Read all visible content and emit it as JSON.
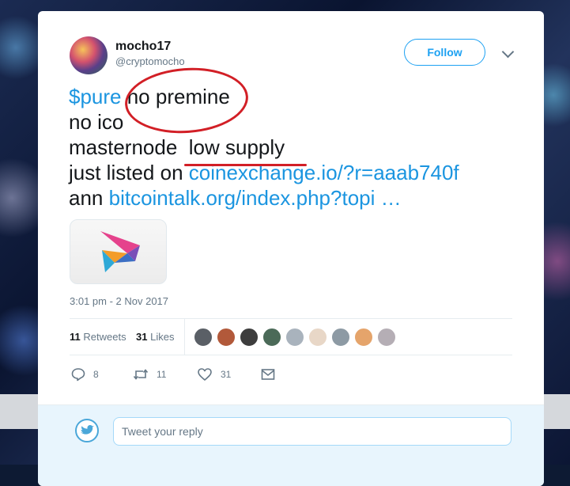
{
  "author": {
    "display_name": "mocho17",
    "handle": "@cryptomocho"
  },
  "follow_label": "Follow",
  "tweet": {
    "cashtag": "$pure",
    "line1_rest": " no premine",
    "line2": "no ico",
    "line3": "masternode  low supply",
    "line4_prefix": "just listed on ",
    "line4_link": "coinexchange.io/?r=aaab740f",
    "line5_prefix": "ann ",
    "line5_link": "bitcointalk.org/index.php?topi …"
  },
  "timestamp": "3:01 pm - 2 Nov 2017",
  "stats": {
    "retweets_count": "11",
    "retweets_label": "Retweets",
    "likes_count": "31",
    "likes_label": "Likes"
  },
  "liker_colors": [
    "#5a5f66",
    "#b2593a",
    "#3d3d3d",
    "#4b6a58",
    "#a9b3bd",
    "#e8d7c7",
    "#8d9aa4",
    "#e5a46b",
    "#b5aeb5"
  ],
  "actions": {
    "reply_count": "8",
    "retweet_count": "11",
    "like_count": "31"
  },
  "icons": {
    "reply": "reply-icon",
    "retweet": "retweet-icon",
    "like": "heart-icon",
    "dm": "envelope-icon",
    "more": "chevron-down-icon"
  },
  "reply": {
    "placeholder": "Tweet your reply"
  },
  "colors": {
    "accent": "#1da1f2",
    "link": "#1b95e0",
    "annotation": "#d21f26"
  }
}
